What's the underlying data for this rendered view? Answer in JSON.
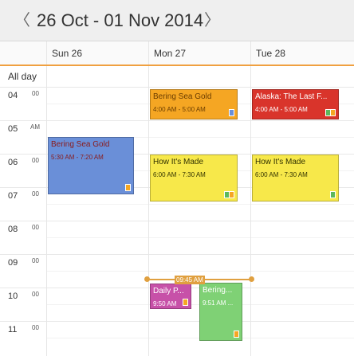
{
  "toolbar": {
    "prev_glyph": "〈",
    "next_glyph": "〉",
    "range": "26 Oct - 01 Nov 2014"
  },
  "days": [
    {
      "label": "Sun 26"
    },
    {
      "label": "Mon 27"
    },
    {
      "label": "Tue 28"
    }
  ],
  "allday_label": "All day",
  "hours": [
    {
      "hour": "04",
      "minute": "00"
    },
    {
      "hour": "05",
      "minute": "AM"
    },
    {
      "hour": "06",
      "minute": "00"
    },
    {
      "hour": "07",
      "minute": "00"
    },
    {
      "hour": "08",
      "minute": "00"
    },
    {
      "hour": "09",
      "minute": "00"
    },
    {
      "hour": "10",
      "minute": "00"
    },
    {
      "hour": "11",
      "minute": "00"
    }
  ],
  "events": [
    {
      "title": "Bering Sea Gold",
      "time": "4:00 AM - 5:00 AM",
      "color": "#f5a623"
    },
    {
      "title": "Alaska: The Last F...",
      "time": "4:00 AM - 5:00 AM",
      "color": "#d9342b"
    },
    {
      "title": "Bering Sea Gold",
      "time": "5:30 AM - 7:20 AM",
      "color": "#6a8fd8"
    },
    {
      "title": "How It's Made",
      "time": "6:00 AM - 7:30 AM",
      "color": "#f7e84a"
    },
    {
      "title": "How It's Made",
      "time": "6:00 AM - 7:30 AM",
      "color": "#f7e84a"
    },
    {
      "title": "Daily P...",
      "time": "9:50 AM",
      "color": "#c751a8"
    },
    {
      "title": "Bering...",
      "time": "9:51 AM ...",
      "color": "#7fd175"
    }
  ],
  "current_time": "09:45 AM",
  "colors": {
    "accent": "#f0a040",
    "badge_orange": "#f5a623",
    "badge_green": "#5cb85c",
    "badge_blue": "#6a8fd8"
  }
}
